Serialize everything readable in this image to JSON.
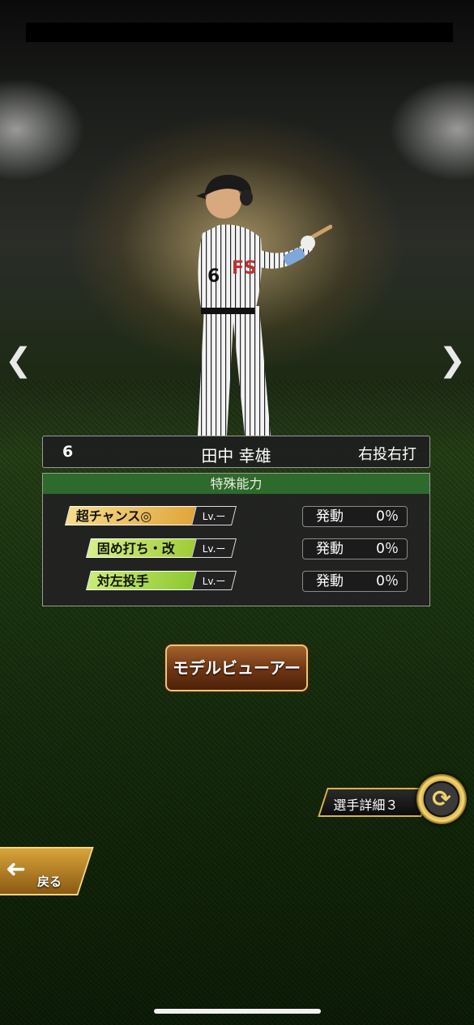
{
  "nav": {
    "prev_icon": "chevron-left-icon",
    "next_icon": "chevron-right-icon",
    "prev_glyph": "❮",
    "next_glyph": "❯"
  },
  "player": {
    "number": "6",
    "name": "田中 幸雄",
    "throw_bat": "右投右打",
    "uniform_number": "6"
  },
  "abilities_panel": {
    "title": "特殊能力",
    "items": [
      {
        "label": "超チャンス◎",
        "level": "Lv.ー",
        "rate_label": "発動",
        "rate_value": "0％",
        "color": "#f0c05a"
      },
      {
        "label": "固め打ち・改",
        "level": "Lv.ー",
        "rate_label": "発動",
        "rate_value": "0％",
        "color": "#b8e04a"
      },
      {
        "label": "対左投手",
        "level": "Lv.ー",
        "rate_label": "発動",
        "rate_value": "0％",
        "color": "#a6dc46"
      }
    ]
  },
  "buttons": {
    "model_viewer": "モデルビューアー",
    "player_detail": "選手詳細３",
    "back": "戻る",
    "switch_icon": "swap-arrows-icon"
  }
}
